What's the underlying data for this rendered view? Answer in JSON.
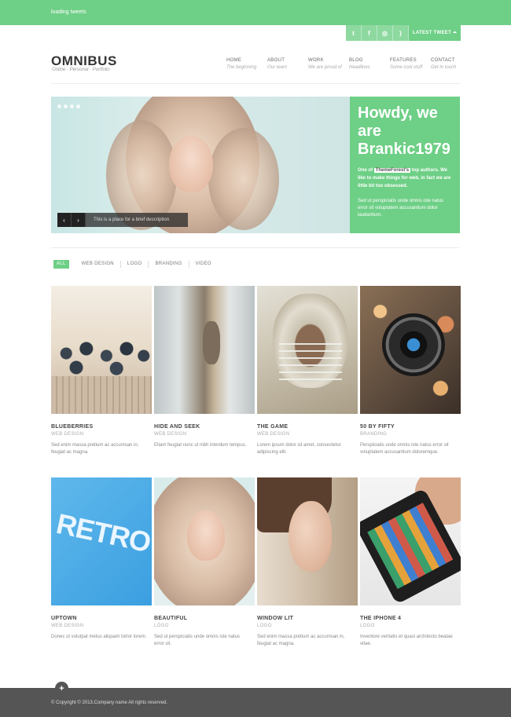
{
  "topbar": {
    "loading": "loading tweets",
    "latest_tweet": "LATEST TWEET ⏶"
  },
  "social": [
    {
      "icon": "twitter-icon",
      "glyph": "t"
    },
    {
      "icon": "facebook-icon",
      "glyph": "f"
    },
    {
      "icon": "dribbble-icon",
      "glyph": "◎"
    },
    {
      "icon": "rss-icon",
      "glyph": ")"
    }
  ],
  "brand": {
    "logo": "OMNIBUS",
    "tagline": "Online · Personal · Portfolio"
  },
  "nav": [
    {
      "title": "HOME",
      "sub": "The beginning"
    },
    {
      "title": "ABOUT",
      "sub": "Our team"
    },
    {
      "title": "WORK",
      "sub": "We are proud of"
    },
    {
      "title": "BLOG",
      "sub": "Headlines"
    },
    {
      "title": "FEATURES",
      "sub": "Some cool stuff"
    },
    {
      "title": "CONTACT",
      "sub": "Get in touch"
    }
  ],
  "slider": {
    "heading": "Howdy, we are Brankic1979",
    "lead_before": "One of ",
    "lead_highlight": "ThemeForest's",
    "lead_after": " top authors. We like to make things for web, in fact we are little bit too obsessed.",
    "body": "Sed ut perspiciatis unde omnis iste natus error sit voluptatem accusantium dolor laudantium.",
    "caption": "This is a place for a brief description",
    "prev": "‹",
    "next": "›"
  },
  "filters": [
    "ALL",
    "WEB DESIGN",
    "LOGO",
    "BRANDING",
    "VIDEO"
  ],
  "portfolio_row1": [
    {
      "title": "BLUEBERRIES",
      "category": "WEB DESIGN",
      "desc": "Sed enim massa pretium ac accumsan in, feugiat ac magna."
    },
    {
      "title": "HIDE AND SEEK",
      "category": "WEB DESIGN",
      "desc": "Etiam feugiat nunc ut nibh interdum tempus."
    },
    {
      "title": "THE GAME",
      "category": "WEB DESIGN",
      "desc": "Lorem ipsum dolor sit amet, consectetur adipiscing elit."
    },
    {
      "title": "50 BY FIFTY",
      "category": "BRANDING",
      "desc": "Perspiciatis unde omnis iste natus error sit voluptatem accusantium doloremque."
    }
  ],
  "portfolio_row2": [
    {
      "title": "UPTOWN",
      "category": "WEB DESIGN",
      "desc": "Donec ut volutpat metus aliquam tortor lorem."
    },
    {
      "title": "BEAUTIFUL",
      "category": "LOGO",
      "desc": "Sed ut perspiciatis unde omnis iste natus error sit."
    },
    {
      "title": "WINDOW LIT",
      "category": "LOGO",
      "desc": "Sed enim massa pretium ac accumsan in, feugiat ac magna."
    },
    {
      "title": "THE IPHONE 4",
      "category": "LOGO",
      "desc": "Inventore veritatis et quasi architecto beatae vitae."
    }
  ],
  "retro_text": "RETRO",
  "footer": {
    "copyright": "© Copyright © 2013.Company name All rights reserved.",
    "plus": "+"
  },
  "colors": {
    "accent": "#6ecf86",
    "footer": "#555555"
  }
}
